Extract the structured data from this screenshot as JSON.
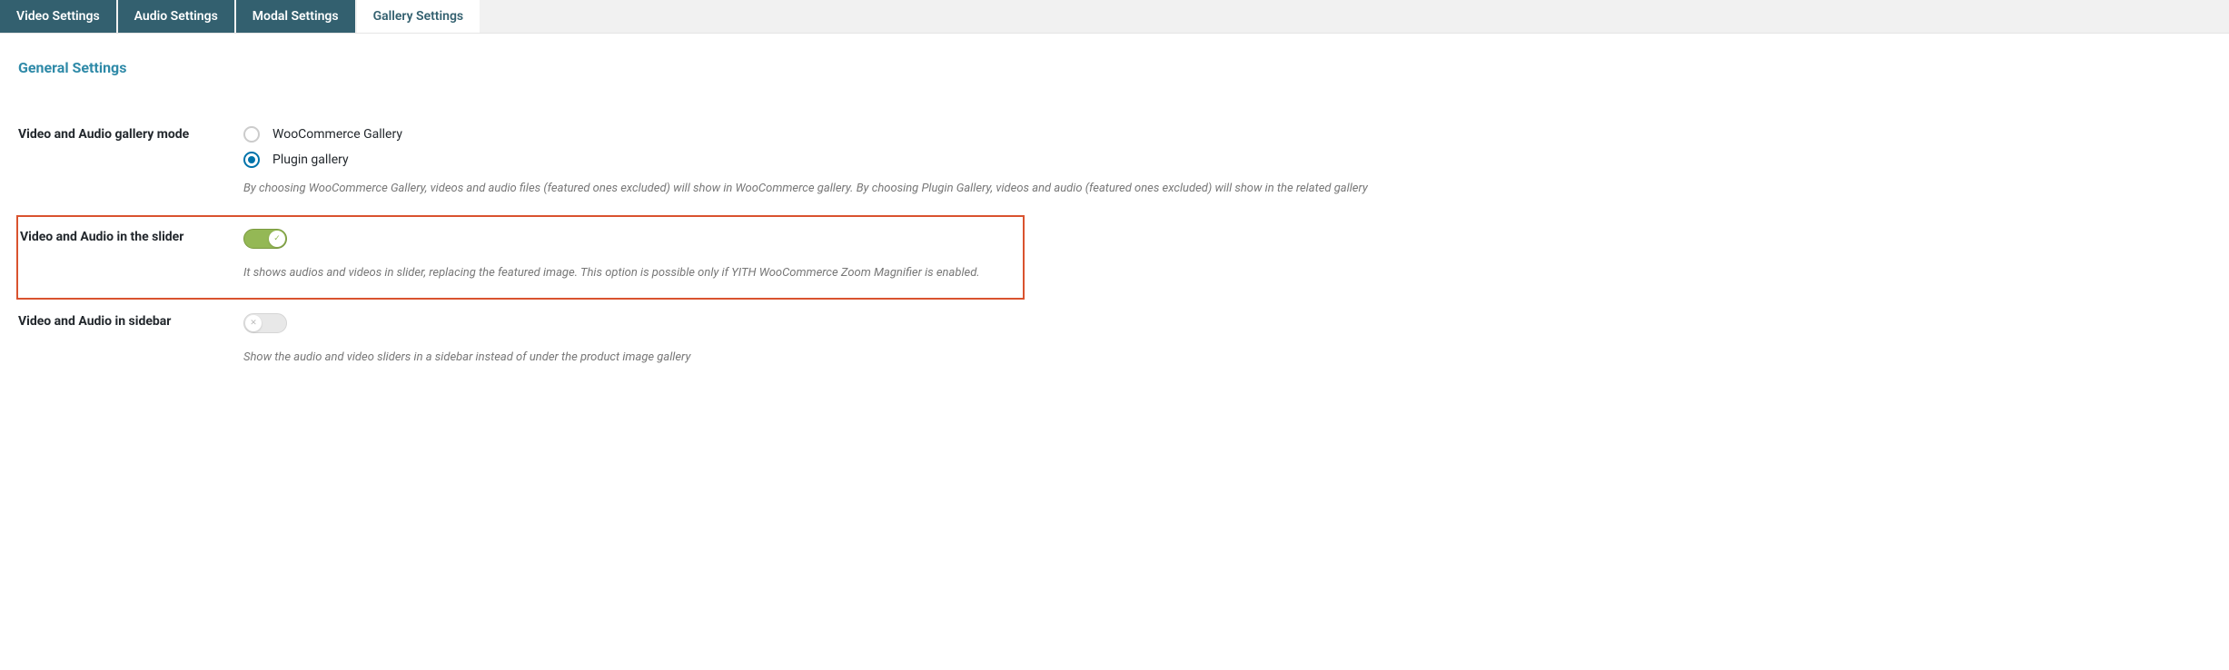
{
  "tabs": [
    {
      "label": "Video Settings",
      "active": false
    },
    {
      "label": "Audio Settings",
      "active": false
    },
    {
      "label": "Modal Settings",
      "active": false
    },
    {
      "label": "Gallery Settings",
      "active": true
    }
  ],
  "section_title": "General Settings",
  "gallery_mode": {
    "label": "Video and Audio gallery mode",
    "options": [
      {
        "label": "WooCommerce Gallery",
        "selected": false
      },
      {
        "label": "Plugin gallery",
        "selected": true
      }
    ],
    "description": "By choosing WooCommerce Gallery, videos and audio files (featured ones excluded) will show in WooCommerce gallery. By choosing Plugin Gallery, videos and audio (featured ones excluded) will show in the related gallery"
  },
  "slider": {
    "label": "Video and Audio in the slider",
    "enabled": true,
    "description": "It shows audios and videos in slider, replacing the featured image. This option is possible only if YITH WooCommerce Zoom Magnifier is enabled."
  },
  "sidebar": {
    "label": "Video and Audio in sidebar",
    "enabled": false,
    "description": "Show the audio and video sliders in a sidebar instead of under the product image gallery"
  }
}
